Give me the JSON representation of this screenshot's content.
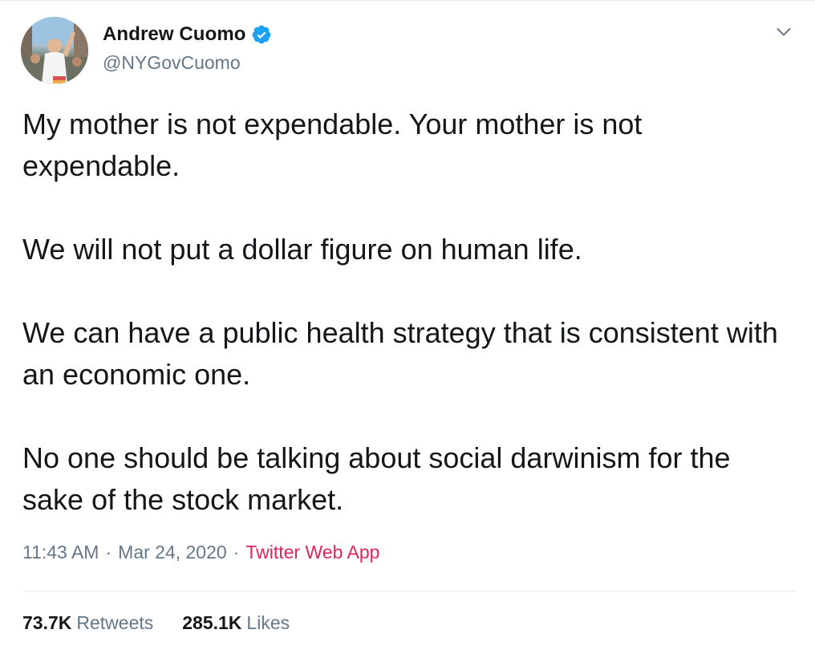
{
  "author": {
    "display_name": "Andrew Cuomo",
    "handle": "@NYGovCuomo",
    "verified": true,
    "verified_icon": "verified-badge-icon",
    "avatar_icon": "profile-photo"
  },
  "menu": {
    "icon": "chevron-down-icon"
  },
  "tweet": {
    "paragraphs": [
      "My mother is not expendable. Your mother is not expendable.",
      "We will not put a dollar figure on human life.",
      "We can have a public health strategy that is consistent with an economic one.",
      "No one should be talking about social darwinism for the sake of the stock market."
    ],
    "time": "11:43 AM",
    "date": "Mar 24, 2020",
    "separator": "·",
    "source": "Twitter Web App"
  },
  "stats": {
    "retweets_count": "73.7K",
    "retweets_label": "Retweets",
    "likes_count": "285.1K",
    "likes_label": "Likes"
  },
  "colors": {
    "text": "#14171a",
    "secondary": "#657786",
    "accent_link": "#e0245e",
    "verified": "#1da1f2",
    "divider": "#e6ecf0"
  }
}
